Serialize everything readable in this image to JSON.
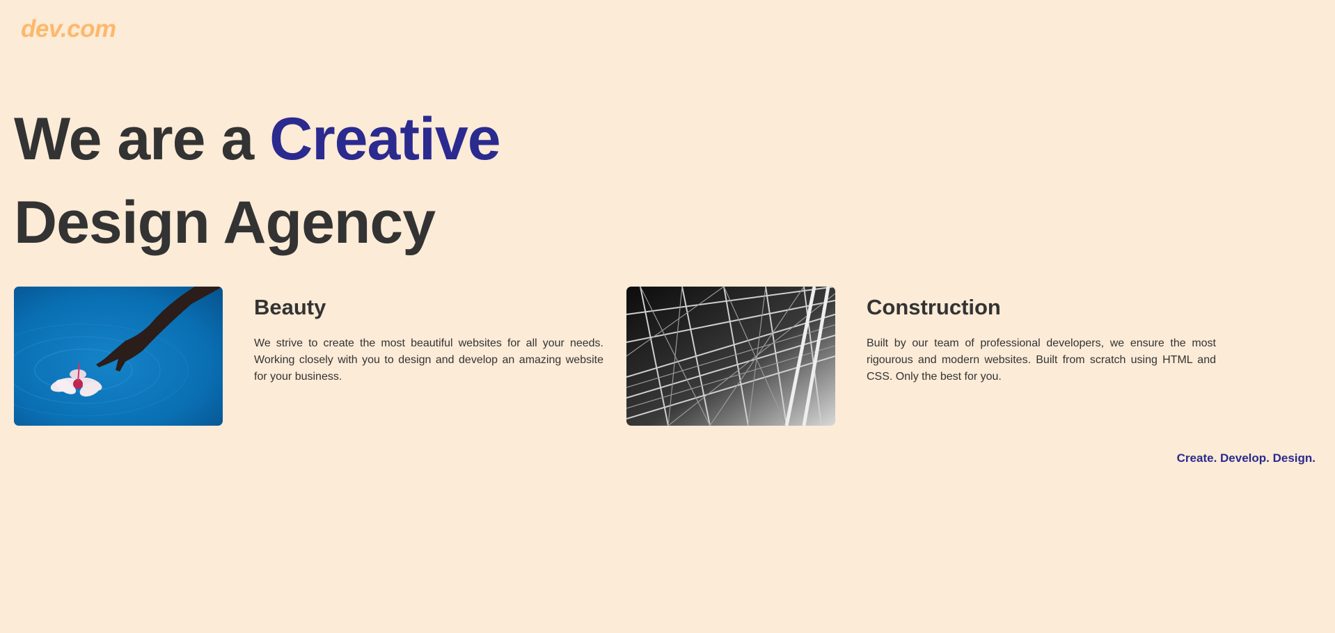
{
  "logo": {
    "text": "dev.com"
  },
  "hero": {
    "line1_prefix": "We are a ",
    "line1_accent": "Creative",
    "line2": "Design Agency"
  },
  "cards": [
    {
      "title": "Beauty",
      "text": "We strive to create the most beautiful websites for all your needs. Working closely with you to design and develop an amazing website for your business.",
      "image_name": "hand-touching-water-with-flower"
    },
    {
      "title": "Construction",
      "text": "Built by our team of professional developers, we ensure the most rigourous and modern websites. Built from scratch using HTML and CSS. Only the best for you.",
      "image_name": "steel-truss-structure"
    }
  ],
  "tagline": "Create. Develop. Design.",
  "colors": {
    "background": "#fbebd7",
    "logo": "#fdb86b",
    "accent": "#2b2a8f",
    "text": "#333333"
  }
}
